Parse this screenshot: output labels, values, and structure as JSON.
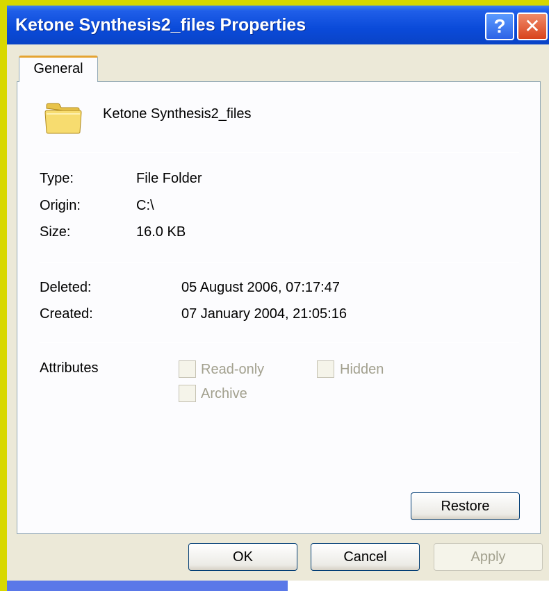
{
  "window": {
    "title": "Ketone Synthesis2_files Properties",
    "help_label": "?",
    "close_label": "✕"
  },
  "tabs": [
    {
      "label": "General"
    }
  ],
  "general": {
    "folder_name": "Ketone Synthesis2_files",
    "icon": "folder-icon",
    "type_label": "Type:",
    "type_value": "File Folder",
    "origin_label": "Origin:",
    "origin_value": "C:\\",
    "size_label": "Size:",
    "size_value": "16.0 KB",
    "deleted_label": "Deleted:",
    "deleted_value": "05 August 2006, 07:17:47",
    "created_label": "Created:",
    "created_value": "07 January 2004, 21:05:16",
    "attributes_label": "Attributes",
    "attributes": [
      {
        "label": "Read-only",
        "checked": false,
        "enabled": false
      },
      {
        "label": "Hidden",
        "checked": false,
        "enabled": false
      },
      {
        "label": "Archive",
        "checked": false,
        "enabled": false
      }
    ],
    "restore_label": "Restore"
  },
  "footer": {
    "ok_label": "OK",
    "cancel_label": "Cancel",
    "apply_label": "Apply"
  },
  "colors": {
    "titlebar": "#0a4ad9",
    "window_face": "#ece9d8",
    "tab_accent": "#e5a431",
    "desktop": "#d8d800"
  }
}
